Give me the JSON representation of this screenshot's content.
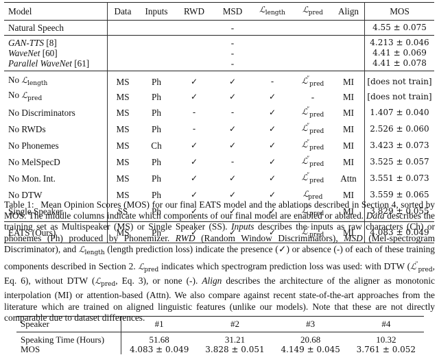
{
  "table1": {
    "headers": {
      "model": "Model",
      "data": "Data",
      "inputs": "Inputs",
      "rwd": "RWD",
      "msd": "MSD",
      "length": "length",
      "pred": "pred",
      "align": "Align",
      "mos": "MOS"
    },
    "natural": {
      "model": "Natural Speech",
      "msd": "-",
      "mos": "4.55 ± 0.075"
    },
    "baselines": [
      {
        "name": "GAN-TTS",
        "ref": "[8]",
        "msd": "-",
        "mos": "4.213 ± 0.046"
      },
      {
        "name": "WaveNet",
        "ref": "[60]",
        "msd": "-",
        "mos": "4.41 ± 0.069"
      },
      {
        "name": "Parallel WaveNet",
        "ref": "[61]",
        "msd": "-",
        "mos": "4.41 ± 0.078"
      }
    ],
    "ablations": [
      {
        "prefix": "No ",
        "loss": "length",
        "model": "",
        "data": "MS",
        "inputs": "Ph",
        "rwd": "✓",
        "msd": "✓",
        "len": "-",
        "pred_prime": "″",
        "pred": "pred",
        "align": "MI",
        "mos": "[does not train]"
      },
      {
        "prefix": "No ",
        "loss": "pred",
        "model": "",
        "data": "MS",
        "inputs": "Ph",
        "rwd": "✓",
        "msd": "✓",
        "len": "✓",
        "pred_dash": "-",
        "align": "MI",
        "mos": "[does not train]"
      },
      {
        "model": "No Discriminators",
        "data": "MS",
        "inputs": "Ph",
        "rwd": "-",
        "msd": "-",
        "len": "✓",
        "pred_prime": "″",
        "pred": "pred",
        "align": "MI",
        "mos": "1.407 ± 0.040"
      },
      {
        "model": "No RWDs",
        "data": "MS",
        "inputs": "Ph",
        "rwd": "-",
        "msd": "✓",
        "len": "✓",
        "pred_prime": "″",
        "pred": "pred",
        "align": "MI",
        "mos": "2.526 ± 0.060"
      },
      {
        "model": "No Phonemes",
        "data": "MS",
        "inputs": "Ch",
        "rwd": "✓",
        "msd": "✓",
        "len": "✓",
        "pred_prime": "″",
        "pred": "pred",
        "align": "MI",
        "mos": "3.423 ± 0.073"
      },
      {
        "model": "No MelSpecD",
        "data": "MS",
        "inputs": "Ph",
        "rwd": "✓",
        "msd": "-",
        "len": "✓",
        "pred_prime": "″",
        "pred": "pred",
        "align": "MI",
        "mos": "3.525 ± 0.057"
      },
      {
        "model": "No Mon. Int.",
        "data": "MS",
        "inputs": "Ph",
        "rwd": "✓",
        "msd": "✓",
        "len": "✓",
        "pred_prime": "″",
        "pred": "pred",
        "align": "Attn",
        "mos": "3.551 ± 0.073"
      },
      {
        "model": "No DTW",
        "data": "MS",
        "inputs": "Ph",
        "rwd": "✓",
        "msd": "✓",
        "len": "✓",
        "pred_prime": "",
        "pred": "pred",
        "align": "MI",
        "mos": "3.559 ± 0.065"
      },
      {
        "model": "Single Speaker",
        "data": "SS",
        "inputs": "Ph",
        "rwd": "✓",
        "msd": "✓",
        "len": "✓",
        "pred_prime": "″",
        "pred": "pred",
        "align": "MI",
        "mos": "3.829 ± 0.055"
      }
    ],
    "final": {
      "model": "EATS (Ours)",
      "data": "MS",
      "inputs": "Ph",
      "rwd": "✓",
      "msd": "✓",
      "len": "✓",
      "pred_prime": "″",
      "pred": "pred",
      "align": "MI",
      "mos": "4.083 ± 0.049"
    },
    "L_symbol": "ℒ"
  },
  "caption": {
    "label": "Table 1:",
    "parts": {
      "p1": "Mean Opinion Scores (MOS) for our final EATS model and the ablations described in Section 4, sorted by MOS. The middle columns indicate which components of our final model are enabled or ablated. ",
      "data_it": "Data",
      "p2": " describes the training set as Multispeaker (MS) or Single Speaker (SS). ",
      "inputs_it": "Inputs",
      "p3": " describes the inputs as raw characters (Ch) or phonemes (Ph) produced by Phonemizer. ",
      "rwd_it": "RWD",
      "p4": " (Random Window Discriminators), ",
      "msd_it": "MSD",
      "p5": " (Mel-spectrogram Discriminator), and ",
      "p6": " (length prediction loss) indicate the presence (✓) or absence (-) of each of these training components described in Section 2. ",
      "p7": " indicates which spectrogram prediction loss was used: with DTW (",
      "p8": ", Eq. 6), without DTW (",
      "p9": ", Eq. 3), or none (-). ",
      "align_it": "Align",
      "p10": " describes the architecture of the aligner as monotonic interpolation (MI) or attention-based (Attn). We also compare against recent state-of-the-art approaches from the literature which are trained on aligned linguistic features (unlike our models). Note that these are not directly comparable due to dataset differences."
    }
  },
  "table2": {
    "header": {
      "label": "Speaker",
      "cols": [
        "#1",
        "#2",
        "#3",
        "#4"
      ]
    },
    "rows": [
      {
        "label": "Speaking Time (Hours)",
        "values": [
          "51.68",
          "31.21",
          "20.68",
          "10.32"
        ]
      },
      {
        "label": "MOS",
        "values": [
          "4.083 ± 0.049",
          "3.828 ± 0.051",
          "4.149 ± 0.045",
          "3.761 ± 0.052"
        ]
      }
    ]
  }
}
